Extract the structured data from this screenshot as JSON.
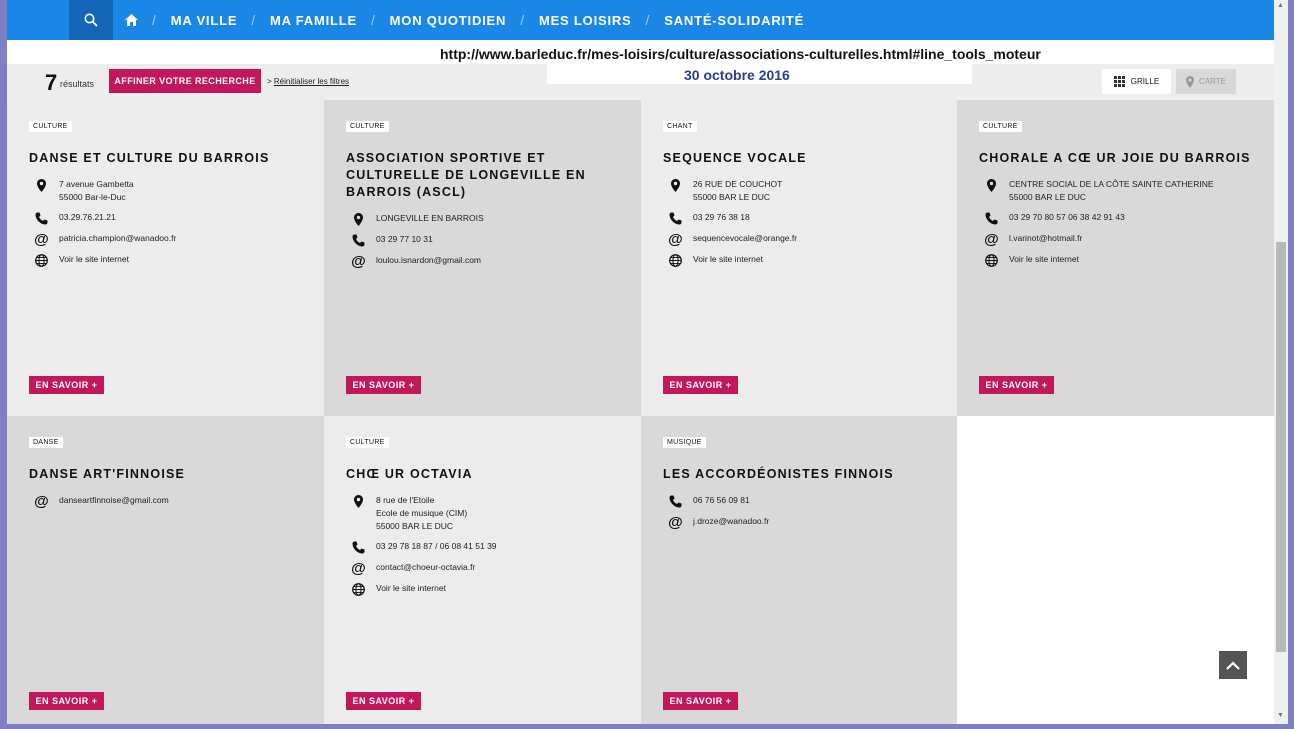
{
  "nav": {
    "items": [
      "MA VILLE",
      "MA FAMILLE",
      "MON QUOTIDIEN",
      "MES LOISIRS",
      "SANTÉ-SOLIDARITÉ"
    ],
    "separator": "/"
  },
  "url_banner": "http://www.barleduc.fr/mes-loisirs/culture/associations-culturelles.html#line_tools_moteur",
  "date_banner": "30 octobre 2016",
  "results": {
    "count": "7",
    "label": "résultats",
    "refine_button": "AFFINER VOTRE RECHERCHE",
    "reset_arrow": ">",
    "reset_link": "Réinitialiser les filtres"
  },
  "view": {
    "grid_label": "GRILLE",
    "map_label": "CARTE"
  },
  "more_label": "EN SAVOIR +",
  "cards": [
    {
      "tag": "CULTURE",
      "title": "DANSE ET CULTURE DU BARROIS",
      "address": "7 avenue Gambetta\n55000 Bar-le-Duc",
      "phone": "03.29.76.21.21",
      "email": "patricia.champion@wanadoo.fr",
      "web": "Voir le site internet"
    },
    {
      "tag": "CULTURE",
      "title": "ASSOCIATION SPORTIVE ET CULTURELLE DE LONGEVILLE EN BARROIS (ASCL)",
      "address": "LONGEVILLE EN BARROIS",
      "phone": "03 29 77 10 31",
      "email": "loulou.isnardon@gmail.com"
    },
    {
      "tag": "CHANT",
      "title": "SEQUENCE VOCALE",
      "address": "26 RUE DE COUCHOT\n55000 BAR LE DUC",
      "phone": "03 29 76 38 18",
      "email": "sequencevocale@orange.fr",
      "web": "Voir le site internet"
    },
    {
      "tag": "CULTURE",
      "title": "CHORALE A CŒ UR JOIE DU BARROIS",
      "address": "CENTRE SOCIAL DE LA CÔTE SAINTE CATHERINE\n55000 BAR LE DUC",
      "phone": "03 29 70 80 57 06 38 42 91 43",
      "email": "l.varinot@hotmail.fr",
      "web": "Voir le site internet"
    },
    {
      "tag": "DANSE",
      "title": "DANSE ART'FINNOISE",
      "email": "danseartfinnoise@gmail.com"
    },
    {
      "tag": "CULTURE",
      "title": "CHŒ UR OCTAVIA",
      "address": "8 rue de l'Etoile\nEcole de musique (CIM)\n55000 BAR LE DUC",
      "phone": "03 29 78 18 87 / 06 08 41 51 39",
      "email": "contact@choeur-octavia.fr",
      "web": "Voir le site internet"
    },
    {
      "tag": "MUSIQUE",
      "title": "LES ACCORDÉONISTES FINNOIS",
      "phone": "06 76 56 09 81",
      "email": "j.droze@wanadoo.fr"
    }
  ],
  "icons": {
    "nav": [
      "search-icon",
      "home-icon"
    ],
    "row": [
      "map-pin-icon",
      "phone-icon",
      "at-icon",
      "globe-icon"
    ]
  },
  "colors": {
    "nav_blue": "#1a86e6",
    "accent": "#c2185b",
    "url_blue": "#2c3f8c"
  }
}
